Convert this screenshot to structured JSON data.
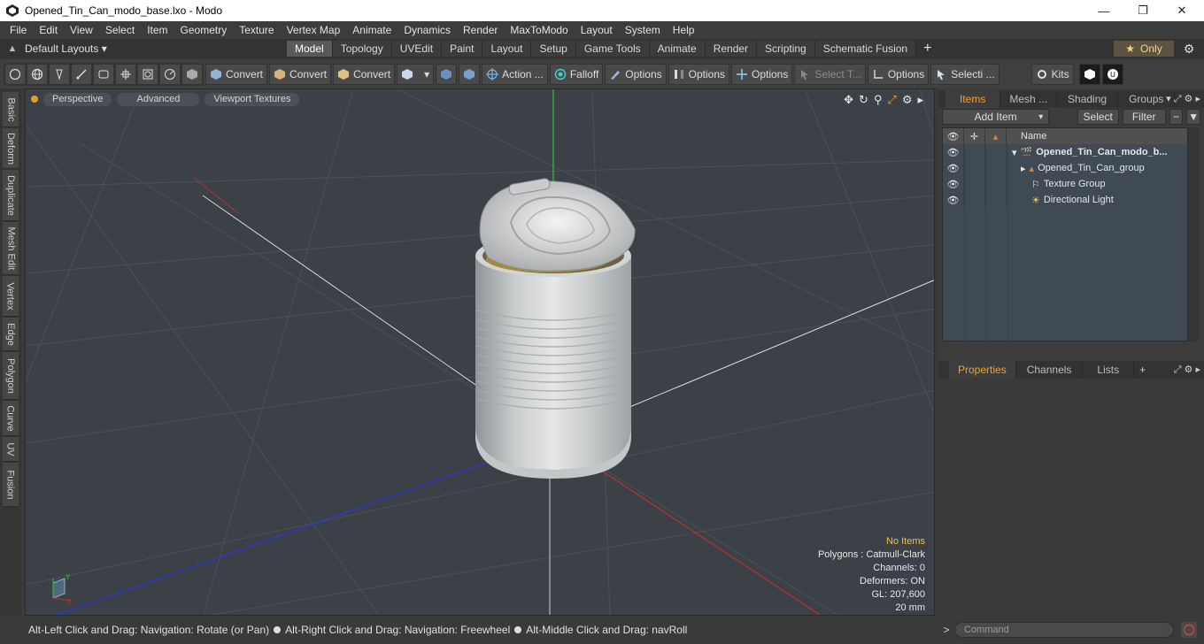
{
  "window": {
    "title": "Opened_Tin_Can_modo_base.lxo - Modo",
    "minimize": "—",
    "maximize": "❐",
    "close": "✕"
  },
  "menu": [
    "File",
    "Edit",
    "View",
    "Select",
    "Item",
    "Geometry",
    "Texture",
    "Vertex Map",
    "Animate",
    "Dynamics",
    "Render",
    "MaxToModo",
    "Layout",
    "System",
    "Help"
  ],
  "layoutbar": {
    "default_layouts": "Default Layouts ▾",
    "tabs": [
      "Model",
      "Topology",
      "UVEdit",
      "Paint",
      "Layout",
      "Setup",
      "Game Tools",
      "Animate",
      "Render",
      "Scripting",
      "Schematic Fusion"
    ],
    "active_tab": "Model",
    "only_label": "Only"
  },
  "toolbar": {
    "convert1": "Convert",
    "convert2": "Convert",
    "convert3": "Convert",
    "action": "Action ...",
    "falloff": "Falloff",
    "options1": "Options",
    "options2": "Options",
    "options3": "Options",
    "select_t": "Select T...",
    "options4": "Options",
    "selecti": "Selecti ...",
    "kits": "Kits"
  },
  "left_tabs": [
    "Basic",
    "Deform",
    "Duplicate",
    "Mesh Edit",
    "Vertex",
    "Edge",
    "Polygon",
    "Curve",
    "UV",
    "Fusion"
  ],
  "viewport": {
    "perspective": "Perspective",
    "advanced": "Advanced",
    "viewport_textures": "Viewport Textures",
    "info": {
      "no_items": "No Items",
      "polygons": "Polygons : Catmull-Clark",
      "channels": "Channels: 0",
      "deformers": "Deformers: ON",
      "gl": "GL: 207,600",
      "unit": "20 mm"
    },
    "axis_y": "Y",
    "axis_x": "X"
  },
  "items_panel": {
    "tabs": [
      "Items",
      "Mesh ...",
      "Shading",
      "Groups"
    ],
    "active_tab": "Items",
    "add_item": "Add Item",
    "select": "Select",
    "filter": "Filter",
    "name_header": "Name",
    "rows": [
      {
        "label": "Opened_Tin_Can_modo_b...",
        "bold": true
      },
      {
        "label": "Opened_Tin_Can_group",
        "bold": false
      },
      {
        "label": "Texture Group",
        "bold": false
      },
      {
        "label": "Directional Light",
        "bold": false
      }
    ]
  },
  "props_panel": {
    "tabs": [
      "Properties",
      "Channels",
      "Lists"
    ],
    "active_tab": "Properties"
  },
  "statusbar": {
    "part1": "Alt-Left Click and Drag: Navigation: Rotate (or Pan)",
    "part2": "Alt-Right Click and Drag: Navigation: Freewheel",
    "part3": "Alt-Middle Click and Drag: navRoll"
  },
  "command": {
    "placeholder": "Command"
  },
  "colors": {
    "accent": "#f0a030",
    "viewport_bg": "#3b4146",
    "x_axis": "#c03030",
    "y_axis": "#30c040",
    "z_axis": "#2a3ad0"
  }
}
